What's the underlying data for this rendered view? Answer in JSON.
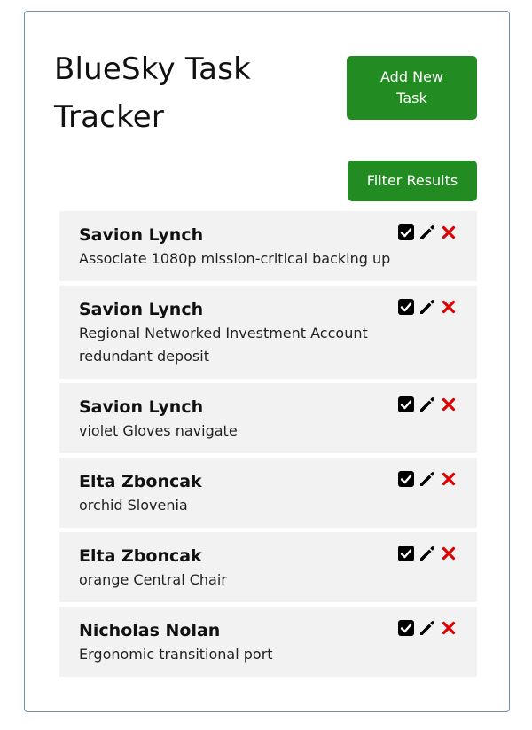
{
  "app": {
    "title": "BlueSky Task Tracker"
  },
  "toolbar": {
    "add_label": "Add New Task",
    "filter_label": "Filter Results"
  },
  "colors": {
    "primary_button": "#228b22",
    "delete_icon": "#e00000",
    "card_border": "#6f8fb3",
    "task_background": "#f2f2f2"
  },
  "icons": {
    "complete": "check-square-icon",
    "edit": "pencil-icon",
    "delete": "x-icon"
  },
  "tasks": [
    {
      "name": "Savion Lynch",
      "description": "Associate 1080p mission-critical backing up"
    },
    {
      "name": "Savion Lynch",
      "description": "Regional Networked Investment Account redundant deposit"
    },
    {
      "name": "Savion Lynch",
      "description": "violet Gloves navigate"
    },
    {
      "name": "Elta Zboncak",
      "description": "orchid Slovenia"
    },
    {
      "name": "Elta Zboncak",
      "description": "orange Central Chair"
    },
    {
      "name": "Nicholas Nolan",
      "description": "Ergonomic transitional port"
    }
  ]
}
